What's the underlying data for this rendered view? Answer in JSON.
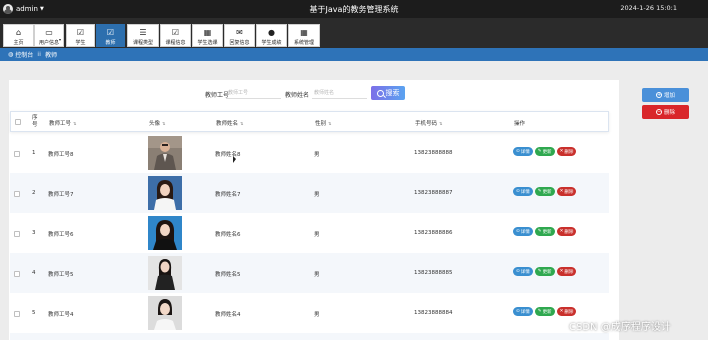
{
  "topbar": {
    "username": "admin",
    "title": "基于Java的教务管理系统",
    "datetime": "2024-1-26 15:0:1"
  },
  "nav": [
    {
      "label": "主页",
      "icon": "home-icon",
      "active": false
    },
    {
      "label": "用户信息",
      "icon": "card-icon",
      "active": false,
      "dropdown": true
    },
    {
      "label": "学生",
      "icon": "check-icon",
      "active": false
    },
    {
      "label": "教师",
      "icon": "check-icon",
      "active": true
    },
    {
      "label": "课程类型",
      "icon": "sliders-icon",
      "active": false
    },
    {
      "label": "课程信息",
      "icon": "check-icon",
      "active": false
    },
    {
      "label": "学生选课",
      "icon": "grid-icon",
      "active": false
    },
    {
      "label": "回复信息",
      "icon": "chat-icon",
      "active": false
    },
    {
      "label": "学生成绩",
      "icon": "pin-icon",
      "active": false
    },
    {
      "label": "系统管理",
      "icon": "grid-icon",
      "active": false
    }
  ],
  "breadcrumb": {
    "home": "控制台",
    "current": "教师"
  },
  "search": {
    "field1_label": "教师工号",
    "field1_placeholder": "教师工号",
    "field2_label": "教师姓名",
    "field2_placeholder": "教师姓名",
    "button_label": "搜索"
  },
  "side_buttons": {
    "add": "增加",
    "delete": "删除"
  },
  "table": {
    "headers": {
      "index": "序号",
      "id": "教师工号",
      "photo": "头像",
      "name": "教师姓名",
      "gender": "性别",
      "phone": "手机号码",
      "ops": "操作"
    },
    "rows": [
      {
        "index": "1",
        "id": "教师工号8",
        "name": "教师姓名8",
        "gender": "男",
        "phone": "13823888888"
      },
      {
        "index": "2",
        "id": "教师工号7",
        "name": "教师姓名7",
        "gender": "男",
        "phone": "13823888887"
      },
      {
        "index": "3",
        "id": "教师工号6",
        "name": "教师姓名6",
        "gender": "男",
        "phone": "13823888886"
      },
      {
        "index": "4",
        "id": "教师工号5",
        "name": "教师姓名5",
        "gender": "男",
        "phone": "13823888885"
      },
      {
        "index": "5",
        "id": "教师工号4",
        "name": "教师姓名4",
        "gender": "男",
        "phone": "13823888884"
      }
    ],
    "actions": {
      "view": "详情",
      "edit": "更新",
      "remove": "删除"
    }
  },
  "watermark": "CSDN @成序程序设计"
}
